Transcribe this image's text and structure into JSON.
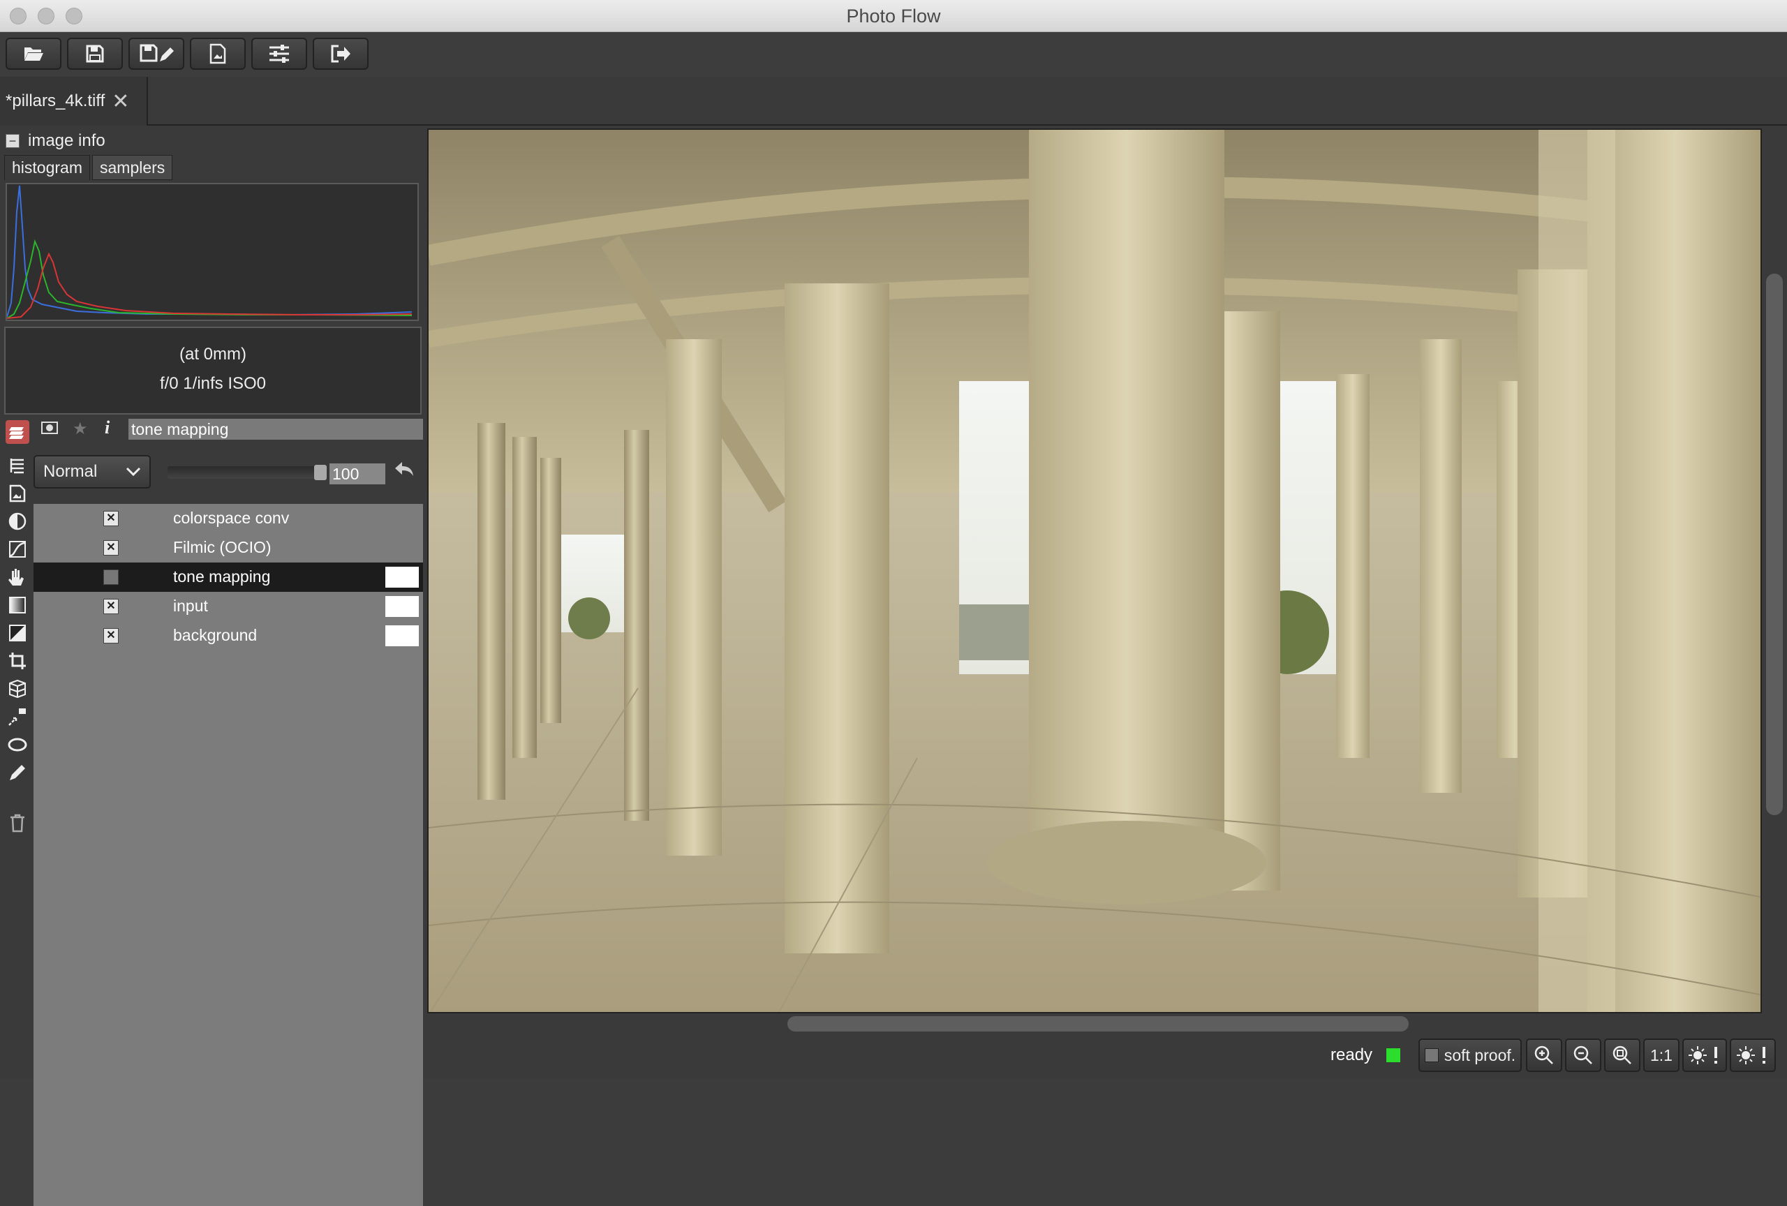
{
  "window": {
    "title": "Photo Flow"
  },
  "toolbar": {
    "buttons": [
      {
        "name": "open-button",
        "icon": "folder-open-icon"
      },
      {
        "name": "save-button",
        "icon": "floppy-disk-icon"
      },
      {
        "name": "save-as-button",
        "icon": "floppy-disk-pencil-icon"
      },
      {
        "name": "export-button",
        "icon": "export-image-icon"
      },
      {
        "name": "settings-button",
        "icon": "sliders-icon"
      },
      {
        "name": "exit-button",
        "icon": "exit-arrow-icon"
      }
    ]
  },
  "tabs": {
    "file": "*pillars_4k.tiff",
    "close": "✕"
  },
  "image_info": {
    "header": "image info",
    "tabs": [
      "histogram",
      "samplers"
    ],
    "focal": "(at 0mm)",
    "exposure": "f/0  1/infs  ISO0"
  },
  "layer_editor": {
    "current_name": "tone mapping",
    "blend_mode": "Normal",
    "opacity": "100",
    "layers": [
      {
        "name": "colorspace conv",
        "enabled": true
      },
      {
        "name": "Filmic (OCIO)",
        "enabled": true
      },
      {
        "name": "tone mapping",
        "enabled": false,
        "selected": true
      },
      {
        "name": "input",
        "enabled": true
      },
      {
        "name": "background",
        "enabled": true
      }
    ]
  },
  "status": {
    "text": "ready",
    "soft_proof": "soft proof.",
    "one_to_one": "1:1",
    "indicator_color": "#2ddd2d"
  },
  "histogram": {
    "channels": [
      "blue",
      "green",
      "red"
    ]
  }
}
